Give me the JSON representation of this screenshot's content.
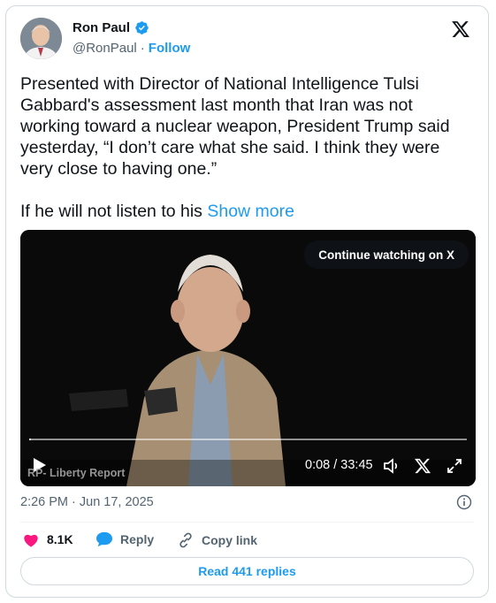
{
  "author": {
    "name": "Ron Paul",
    "handle": "@RonPaul",
    "separator": "·",
    "follow_label": "Follow"
  },
  "tweet": {
    "text": "Presented with Director of National Intelligence Tulsi Gabbard's assessment last month that Iran was not working toward a nuclear weapon, President Trump said yesterday, “I don’t care what she said. I think they were very close to having one.”\n\nIf he will not listen to his ",
    "show_more_label": "Show more"
  },
  "video": {
    "continue_label": "Continue watching on X",
    "watermark": "RP- Liberty Report",
    "time_display": "0:08 / 33:45",
    "progress_fraction": 0.004
  },
  "meta": {
    "timestamp": "2:26 PM · Jun 17, 2025"
  },
  "actions": {
    "likes": "8.1K",
    "reply_label": "Reply",
    "copy_link_label": "Copy link",
    "read_replies_label": "Read 441 replies"
  },
  "colors": {
    "accent": "#1d9bf0",
    "like": "#f91880",
    "muted": "#536471"
  },
  "icons": [
    "verified-badge-icon",
    "x-logo-icon",
    "play-icon",
    "volume-icon",
    "x-small-icon",
    "fullscreen-icon",
    "info-icon",
    "heart-icon",
    "reply-bubble-icon",
    "link-icon"
  ]
}
